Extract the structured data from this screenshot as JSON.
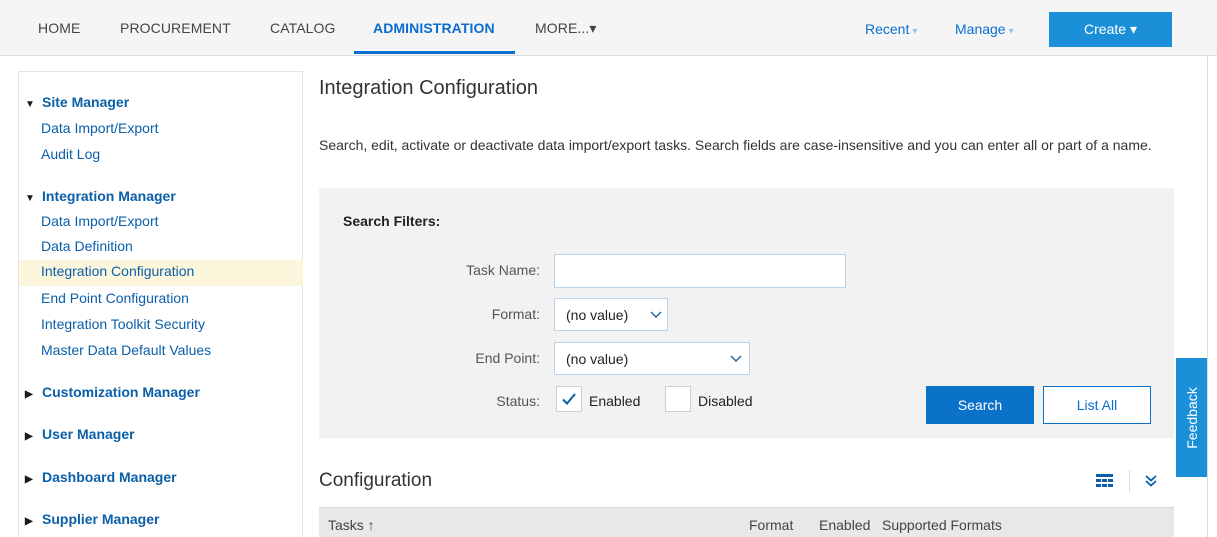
{
  "nav": {
    "items": [
      {
        "label": "HOME"
      },
      {
        "label": "PROCUREMENT"
      },
      {
        "label": "CATALOG"
      },
      {
        "label": "ADMINISTRATION",
        "active": true
      },
      {
        "label": "MORE...▾"
      }
    ],
    "recent": "Recent",
    "manage": "Manage",
    "create": "Create ▾",
    "caret": "▾"
  },
  "sidebar": {
    "sections": [
      {
        "title": "Site Manager",
        "expanded": true,
        "toggle": "▼",
        "items": [
          "Data Import/Export",
          "Audit Log"
        ]
      },
      {
        "title": "Integration Manager",
        "expanded": true,
        "toggle": "▼",
        "items": [
          "Data Import/Export",
          "Data Definition",
          "Integration Configuration",
          "End Point Configuration",
          "Integration Toolkit Security",
          "Master Data Default Values"
        ],
        "selected": "Integration Configuration"
      },
      {
        "title": "Customization Manager",
        "expanded": false,
        "toggle": "▶"
      },
      {
        "title": "User Manager",
        "expanded": false,
        "toggle": "▶"
      },
      {
        "title": "Dashboard Manager",
        "expanded": false,
        "toggle": "▶"
      },
      {
        "title": "Supplier Manager",
        "expanded": false,
        "toggle": "▶"
      }
    ]
  },
  "page": {
    "title": "Integration Configuration",
    "description": "Search, edit, activate or deactivate data import/export tasks. Search fields are case-insensitive and you can enter all or part of a name."
  },
  "filters": {
    "title": "Search Filters:",
    "task_name_label": "Task Name:",
    "task_name_value": "",
    "format_label": "Format:",
    "format_value": "(no value)",
    "end_point_label": "End Point:",
    "end_point_value": "(no value)",
    "status_label": "Status:",
    "enabled_label": "Enabled",
    "enabled_checked": true,
    "disabled_label": "Disabled",
    "disabled_checked": false,
    "search_button": "Search",
    "list_all_button": "List All"
  },
  "configuration": {
    "title": "Configuration",
    "columns": [
      "Tasks ↑",
      "Format",
      "Enabled",
      "Supported Formats"
    ]
  },
  "feedback": "Feedback",
  "colors": {
    "accent": "#0a6ed1",
    "button": "#0a72c9",
    "create": "#1b90d8",
    "selection": "#fcf6dd",
    "panel": "#f2f2f2"
  }
}
